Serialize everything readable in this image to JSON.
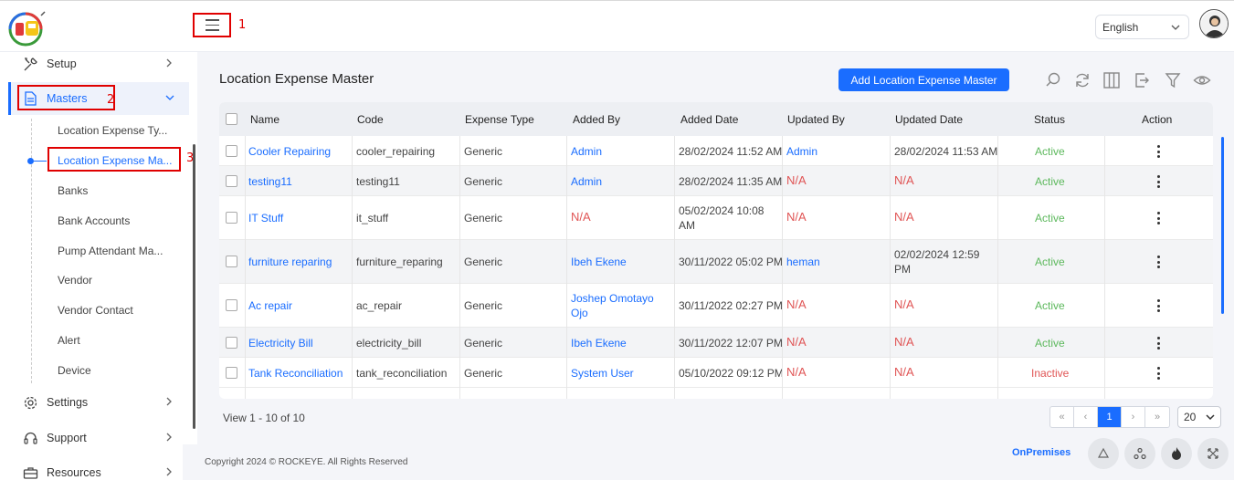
{
  "header": {
    "language": "English",
    "annotations": [
      "1",
      "2",
      "3"
    ]
  },
  "sidebar": {
    "items": [
      {
        "label": "Setup",
        "icon": "tools-icon"
      },
      {
        "label": "Masters",
        "icon": "document-icon"
      },
      {
        "label": "Settings",
        "icon": "gear-icon"
      },
      {
        "label": "Support",
        "icon": "headset-icon"
      },
      {
        "label": "Resources",
        "icon": "briefcase-icon"
      }
    ],
    "sub_items": [
      "Location Expense Ty...",
      "Location Expense Ma...",
      "Banks",
      "Bank Accounts",
      "Pump Attendant Ma...",
      "Vendor",
      "Vendor Contact",
      "Alert",
      "Device"
    ]
  },
  "main": {
    "title": "Location Expense Master",
    "add_button": "Add Location Expense Master",
    "toolbar_icons": [
      "search-icon",
      "refresh-icon",
      "columns-icon",
      "export-icon",
      "filter-icon",
      "eye-icon"
    ],
    "columns": [
      "Name",
      "Code",
      "Expense Type",
      "Added By",
      "Added Date",
      "Updated By",
      "Updated Date",
      "Status",
      "Action"
    ],
    "rows": [
      {
        "name": "Cooler Repairing",
        "code": "cooler_repairing",
        "type": "Generic",
        "added_by": "Admin",
        "added_date": "28/02/2024 11:52 AM",
        "updated_by": "Admin",
        "updated_date": "28/02/2024 11:53 AM",
        "status": "Active"
      },
      {
        "name": "testing11",
        "code": "testing11",
        "type": "Generic",
        "added_by": "Admin",
        "added_date": "28/02/2024 11:35 AM",
        "updated_by": "N/A",
        "updated_date": "N/A",
        "status": "Active"
      },
      {
        "name": "IT Stuff",
        "code": "it_stuff",
        "type": "Generic",
        "added_by": "N/A",
        "added_date": "05/02/2024 10:08 AM",
        "updated_by": "N/A",
        "updated_date": "N/A",
        "status": "Active"
      },
      {
        "name": "furniture reparing",
        "code": "furniture_reparing",
        "type": "Generic",
        "added_by": "Ibeh Ekene",
        "added_date": "30/11/2022 05:02 PM",
        "updated_by": "heman",
        "updated_date": "02/02/2024 12:59 PM",
        "status": "Active"
      },
      {
        "name": "Ac repair",
        "code": "ac_repair",
        "type": "Generic",
        "added_by": "Joshep Omotayo Ojo",
        "added_date": "30/11/2022 02:27 PM",
        "updated_by": "N/A",
        "updated_date": "N/A",
        "status": "Active"
      },
      {
        "name": "Electricity Bill",
        "code": "electricity_bill",
        "type": "Generic",
        "added_by": "Ibeh Ekene",
        "added_date": "30/11/2022 12:07 PM",
        "updated_by": "N/A",
        "updated_date": "N/A",
        "status": "Active"
      },
      {
        "name": "Tank Reconciliation",
        "code": "tank_reconciliation",
        "type": "Generic",
        "added_by": "System User",
        "added_date": "05/10/2022 09:12 PM",
        "updated_by": "N/A",
        "updated_date": "N/A",
        "status": "Inactive"
      }
    ],
    "view_info": "View 1 - 10 of 10",
    "pager": {
      "first": "«",
      "prev": "‹",
      "current": "1",
      "next": "›",
      "last": "»"
    },
    "per_page": "20"
  },
  "footer": {
    "copyright": "Copyright 2024 © ROCKEYE. All Rights Reserved",
    "mode": "OnPremises"
  },
  "colors": {
    "accent": "#1a6dff",
    "annotation": "#e00000",
    "active": "#5cb85c",
    "na": "#e05555"
  }
}
